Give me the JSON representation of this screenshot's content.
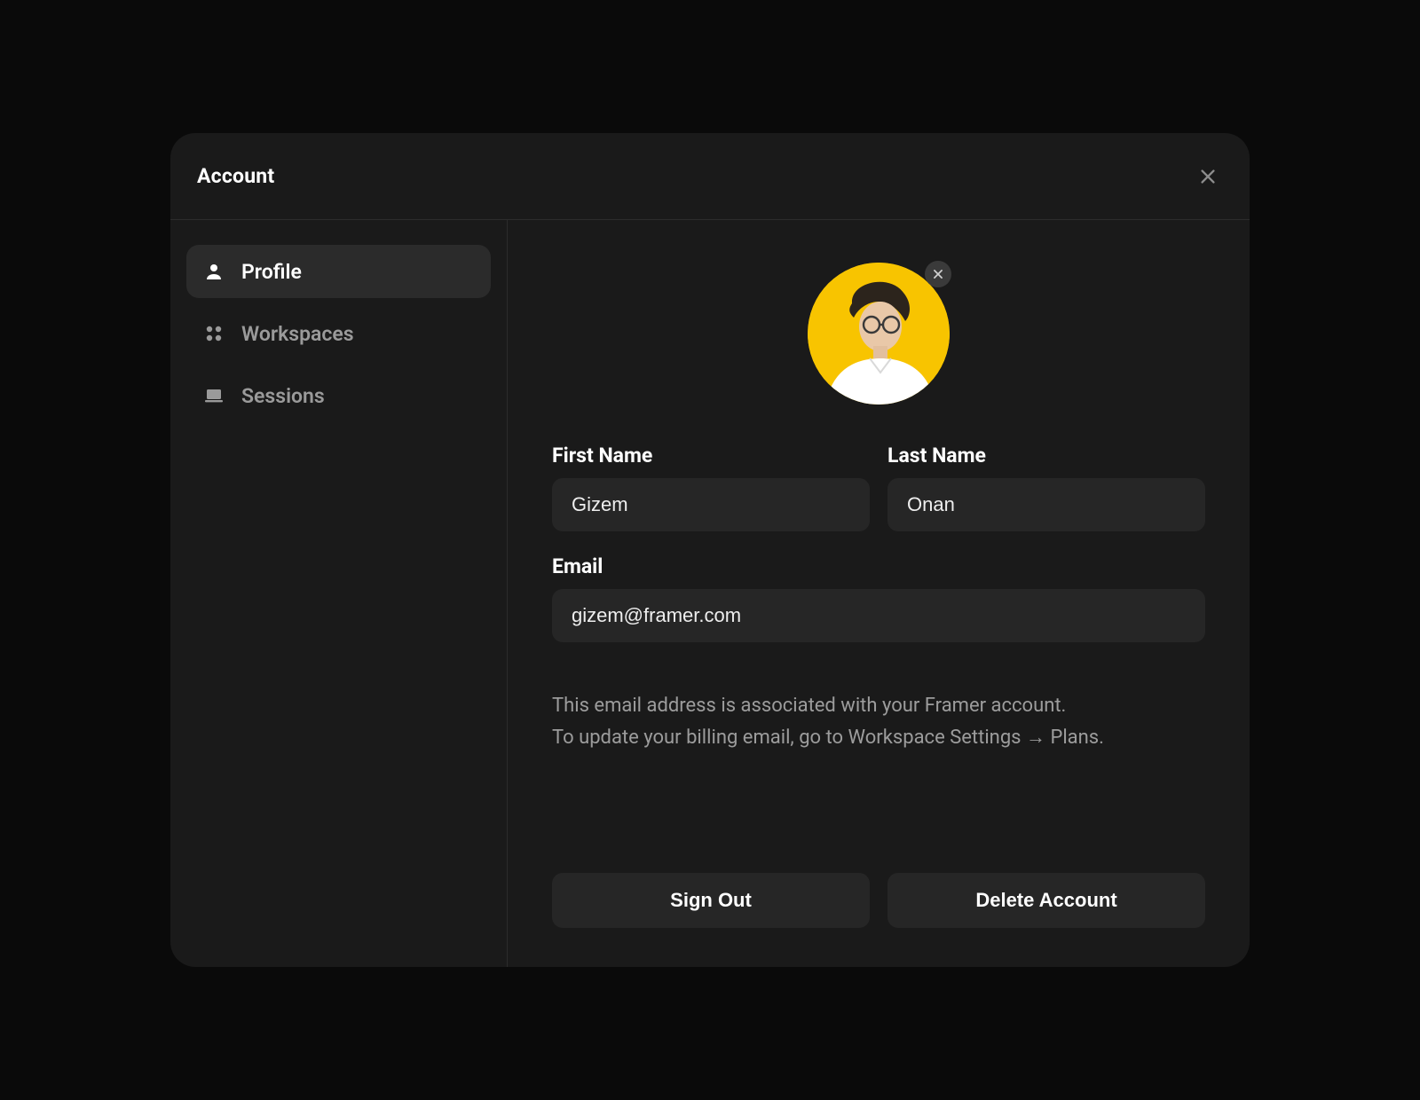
{
  "header": {
    "title": "Account"
  },
  "sidebar": {
    "items": [
      {
        "label": "Profile",
        "icon": "person-icon",
        "active": true
      },
      {
        "label": "Workspaces",
        "icon": "grid-icon",
        "active": false
      },
      {
        "label": "Sessions",
        "icon": "laptop-icon",
        "active": false
      }
    ]
  },
  "profile": {
    "avatar_bg": "#f8c400",
    "first_name_label": "First Name",
    "first_name_value": "Gizem",
    "last_name_label": "Last Name",
    "last_name_value": "Onan",
    "email_label": "Email",
    "email_value": "gizem@framer.com",
    "email_help_line1": "This email address is associated with your Framer account.",
    "email_help_line2": "To update your billing email, go to Workspace Settings → Plans."
  },
  "actions": {
    "sign_out_label": "Sign Out",
    "delete_account_label": "Delete Account"
  }
}
